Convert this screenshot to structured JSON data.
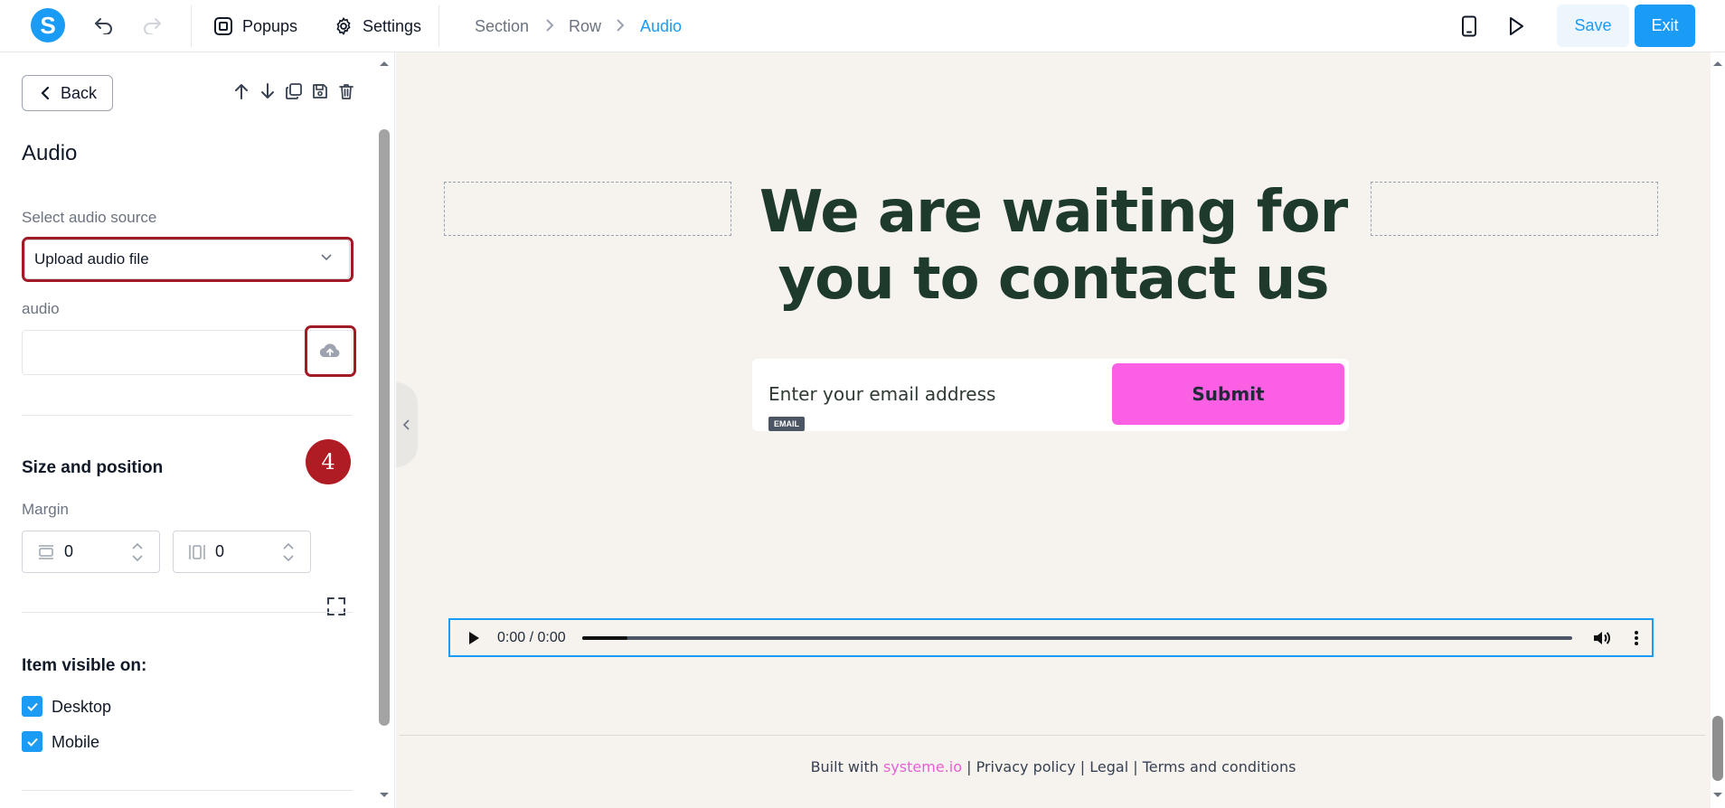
{
  "topbar": {
    "logo_letter": "S",
    "popups_label": "Popups",
    "settings_label": "Settings",
    "breadcrumbs": [
      "Section",
      "Row",
      "Audio"
    ],
    "save_label": "Save",
    "exit_label": "Exit"
  },
  "sidebar": {
    "back_label": "Back",
    "title": "Audio",
    "source_label": "Select audio source",
    "source_value": "Upload audio file",
    "audio_label": "audio",
    "step_badge": "4",
    "size_title": "Size and position",
    "margin_label": "Margin",
    "margin_vertical": "0",
    "margin_horizontal": "0",
    "visible_title": "Item visible on:",
    "visibility": [
      {
        "label": "Desktop",
        "checked": true
      },
      {
        "label": "Mobile",
        "checked": true
      }
    ]
  },
  "canvas": {
    "headline_line1": "We are waiting for",
    "headline_line2": "you to contact us",
    "email_placeholder": "Enter your email address",
    "email_tag": "EMAIL",
    "submit_label": "Submit",
    "audio_time": "0:00 / 0:00",
    "footer": {
      "built_with": "Built with",
      "brand": "systeme.io",
      "links": [
        "Privacy policy",
        "Legal",
        "Terms and conditions"
      ]
    }
  },
  "colors": {
    "accent": "#1a9bf5",
    "highlight": "#a11a26",
    "submit": "#fb5fe3",
    "headline": "#1e3a2c",
    "canvas_bg": "#f6f3ef"
  }
}
